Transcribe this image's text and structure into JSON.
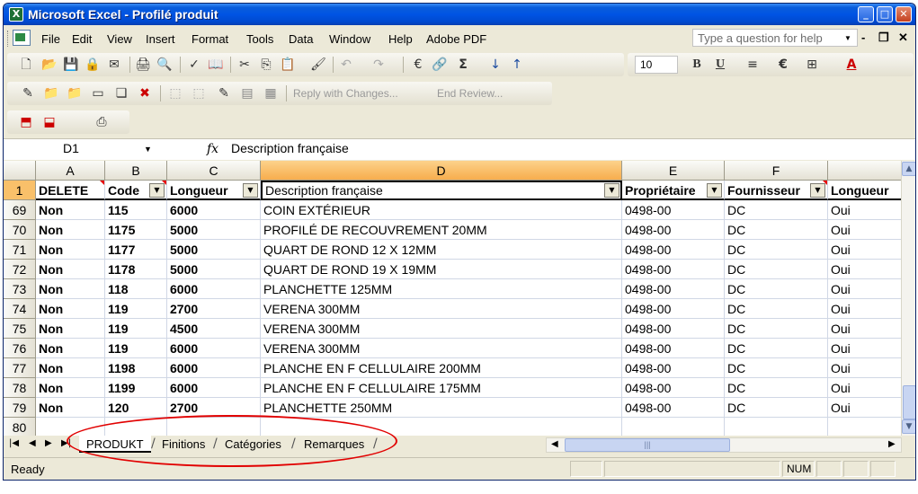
{
  "window": {
    "title": "Microsoft Excel - Profilé produit",
    "app_icon": "excel-icon",
    "app_icon_glyph": "X",
    "buttons": [
      "minimize-icon",
      "maximize-icon",
      "close-icon"
    ],
    "button_glyphs": {
      "minimize": "_",
      "maximize": "□",
      "close": "✕"
    }
  },
  "menubar": {
    "items": [
      "File",
      "Edit",
      "View",
      "Insert",
      "Format",
      "Tools",
      "Data",
      "Window",
      "Help",
      "Adobe PDF"
    ],
    "ask_placeholder": "Type a question for help",
    "mdi_glyphs": {
      "minimize": "-",
      "restore": "❐",
      "close": "✕"
    }
  },
  "toolbar_standard": {
    "font_size": "10",
    "glyphs": {
      "new": "🗋",
      "open": "📂",
      "save": "💾",
      "permission": "🔒",
      "email": "✉",
      "print": "🖨",
      "preview": "🔍",
      "spelling": "✓",
      "research": "📖",
      "cut": "✂",
      "copy": "⎘",
      "paste": "📋",
      "format_painter": "🖌",
      "undo": "↶",
      "redo": "↷",
      "euro": "€",
      "hyperlink": "🔗",
      "autosum": "Σ",
      "sort_asc": "↓",
      "sort_desc": "↑",
      "bold": "B",
      "underline": "U",
      "align": "≡",
      "currency": "€",
      "borders": "⊞",
      "font_color": "A"
    }
  },
  "toolbar_reviewing": {
    "reply_label": "Reply with Changes...",
    "end_label": "End Review..."
  },
  "formula_bar": {
    "name_box": "D1",
    "fx": "fx",
    "content": "Description française"
  },
  "columns": [
    "A",
    "B",
    "C",
    "D",
    "E",
    "F",
    ""
  ],
  "header_row": {
    "row": "1",
    "cells": [
      "DELETE",
      "Code",
      "Longueur",
      "Description française",
      "Propriétaire",
      "Fournisseur",
      "Longueur"
    ]
  },
  "rows": [
    {
      "row": "69",
      "cells": [
        "Non",
        "115",
        "6000",
        "COIN EXTÉRIEUR",
        "0498-00",
        "DC",
        "Oui"
      ]
    },
    {
      "row": "70",
      "cells": [
        "Non",
        "1175",
        "5000",
        "PROFILÉ DE RECOUVREMENT 20MM",
        "0498-00",
        "DC",
        "Oui"
      ]
    },
    {
      "row": "71",
      "cells": [
        "Non",
        "1177",
        "5000",
        "QUART DE ROND 12 X 12MM",
        "0498-00",
        "DC",
        "Oui"
      ]
    },
    {
      "row": "72",
      "cells": [
        "Non",
        "1178",
        "5000",
        "QUART DE ROND 19 X 19MM",
        "0498-00",
        "DC",
        "Oui"
      ]
    },
    {
      "row": "73",
      "cells": [
        "Non",
        "118",
        "6000",
        "PLANCHETTE 125MM",
        "0498-00",
        "DC",
        "Oui"
      ]
    },
    {
      "row": "74",
      "cells": [
        "Non",
        "119",
        "2700",
        "VERENA 300MM",
        "0498-00",
        "DC",
        "Oui"
      ]
    },
    {
      "row": "75",
      "cells": [
        "Non",
        "119",
        "4500",
        "VERENA 300MM",
        "0498-00",
        "DC",
        "Oui"
      ]
    },
    {
      "row": "76",
      "cells": [
        "Non",
        "119",
        "6000",
        "VERENA 300MM",
        "0498-00",
        "DC",
        "Oui"
      ]
    },
    {
      "row": "77",
      "cells": [
        "Non",
        "1198",
        "6000",
        "PLANCHE EN F CELLULAIRE 200MM",
        "0498-00",
        "DC",
        "Oui"
      ]
    },
    {
      "row": "78",
      "cells": [
        "Non",
        "1199",
        "6000",
        "PLANCHE EN F CELLULAIRE 175MM",
        "0498-00",
        "DC",
        "Oui"
      ]
    },
    {
      "row": "79",
      "cells": [
        "Non",
        "120",
        "2700",
        "PLANCHETTE 250MM",
        "0498-00",
        "DC",
        "Oui"
      ]
    },
    {
      "row": "80",
      "cells": [
        "",
        "",
        "",
        "",
        "",
        "",
        ""
      ]
    }
  ],
  "sheet_tabs": [
    "PRODUKT",
    "Finitions",
    "Catégories",
    "Remarques"
  ],
  "active_sheet": "PRODUKT",
  "tab_nav_glyphs": {
    "first": "|◀",
    "prev": "◀",
    "next": "▶",
    "last": "▶|"
  },
  "statusbar": {
    "status": "Ready",
    "num": "NUM"
  },
  "colors": {
    "title_bar": "#0054e3",
    "selected_header": "#f7ad4d",
    "annotation": "#e10000"
  }
}
